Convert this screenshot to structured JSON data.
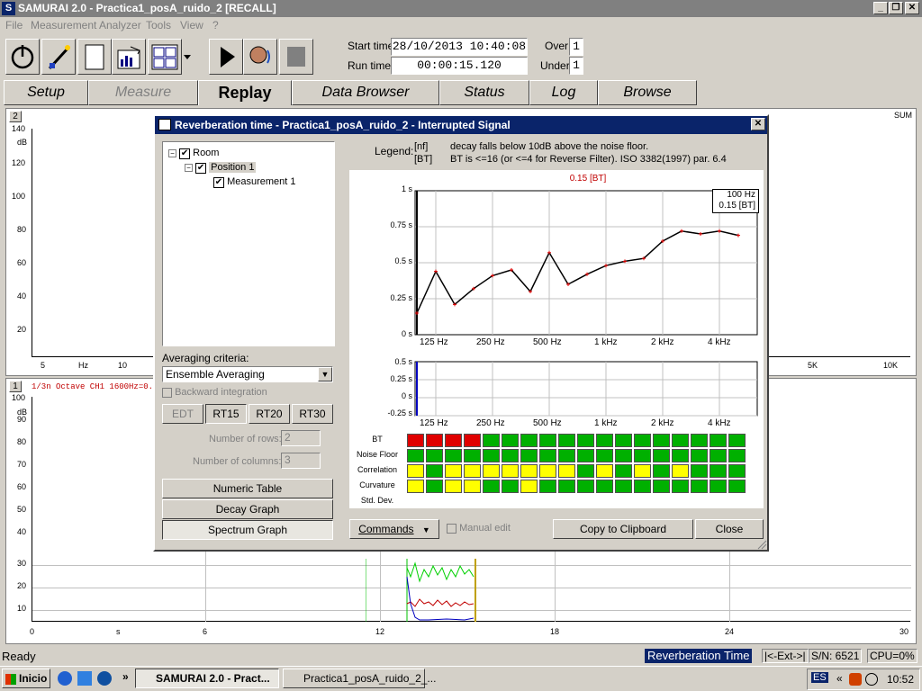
{
  "app": {
    "title": "SAMURAI 2.0 - Practica1_posA_ruido_2 [RECALL]",
    "icon_letter": "S"
  },
  "menu": [
    "File",
    "Measurement",
    "Analyzer",
    "Tools",
    "View",
    "?"
  ],
  "toolbar": {
    "start_time_label": "Start time",
    "start_time": "28/10/2013 10:40:08",
    "run_time_label": "Run time",
    "run_time": "00:00:15.120",
    "over_label": "Over",
    "over_value": "1",
    "under_label": "Under",
    "under_value": "1"
  },
  "tabs": [
    "Setup",
    "Measure",
    "Replay",
    "Data Browser",
    "Status",
    "Log",
    "Browse"
  ],
  "active_tab": "Replay",
  "panel_top": {
    "number": "2",
    "right_label": "SUM",
    "unit": "dB",
    "y_ticks": [
      "140",
      "120",
      "100",
      "80",
      "60",
      "40",
      "20"
    ],
    "x_ticks_left": [
      "5",
      "Hz",
      "10"
    ],
    "x_ticks_right": [
      "5K",
      "10K"
    ]
  },
  "panel_bottom": {
    "number": "1",
    "info": "1/3n Octave CH1 1600Hz=0.0dB",
    "unit": "dB",
    "y_ticks": [
      "100",
      "90",
      "80",
      "70",
      "60",
      "50",
      "40",
      "30",
      "20",
      "10"
    ],
    "x_ticks": [
      "0",
      "s",
      "6",
      "12",
      "18",
      "24",
      "30"
    ]
  },
  "dialog": {
    "title": "Reverberation time - Practica1_posA_ruido_2 - Interrupted Signal",
    "close_glyph": "✕",
    "tree": {
      "room": "Room",
      "position": "Position 1",
      "measurement": "Measurement 1"
    },
    "legend_label": "Legend:",
    "legend_nf_key": "[nf]",
    "legend_nf_text": "decay falls below 10dB above the noise floor.",
    "legend_bt_key": "[BT]",
    "legend_bt_text": "BT is <=16 (or <=4 for Reverse Filter). ISO 3382(1997) par. 6.4",
    "averaging_label": "Averaging criteria:",
    "averaging_value": "Ensemble Averaging",
    "backward_label": "Backward integration",
    "rt_buttons": [
      "EDT",
      "RT15",
      "RT20",
      "RT30"
    ],
    "rows_label": "Number of rows:",
    "rows_value": "2",
    "cols_label": "Number of columns:",
    "cols_value": "3",
    "view_buttons": [
      "Numeric Table",
      "Decay Graph",
      "Spectrum Graph"
    ],
    "commands_label": "Commands",
    "manual_edit_label": "Manual edit",
    "copy_label": "Copy to Clipboard",
    "close_label": "Close",
    "chart_header": "0.15 [BT]",
    "tooltip_freq": "100 Hz",
    "tooltip_val": "0.15 [BT]",
    "grid_rows": [
      "BT",
      "Noise Floor",
      "Correlation",
      "Curvature",
      "Std. Dev."
    ],
    "grid_cells": [
      [
        "r",
        "r",
        "r",
        "r",
        "g",
        "g",
        "g",
        "g",
        "g",
        "g",
        "g",
        "g",
        "g",
        "g",
        "g",
        "g",
        "g",
        "g"
      ],
      [
        "g",
        "g",
        "g",
        "g",
        "g",
        "g",
        "g",
        "g",
        "g",
        "g",
        "g",
        "g",
        "g",
        "g",
        "g",
        "g",
        "g",
        "g"
      ],
      [
        "y",
        "g",
        "y",
        "y",
        "y",
        "y",
        "y",
        "y",
        "y",
        "g",
        "y",
        "g",
        "y",
        "g",
        "y",
        "g",
        "g",
        "g"
      ],
      [
        "y",
        "g",
        "y",
        "y",
        "g",
        "g",
        "y",
        "g",
        "g",
        "g",
        "g",
        "g",
        "g",
        "g",
        "g",
        "g",
        "g",
        "g"
      ]
    ],
    "colors": {
      "green": "#00b000",
      "red": "#e00000",
      "yellow": "#ffff00"
    }
  },
  "chart_data": [
    {
      "type": "line",
      "x": [
        "100 Hz",
        "125 Hz",
        "160 Hz",
        "200 Hz",
        "250 Hz",
        "315 Hz",
        "400 Hz",
        "500 Hz",
        "630 Hz",
        "800 Hz",
        "1 kHz",
        "1.25 kHz",
        "1.6 kHz",
        "2 kHz",
        "2.5 kHz",
        "3.15 kHz",
        "4 kHz",
        "5 kHz"
      ],
      "x_tick_labels": [
        "125 Hz",
        "250 Hz",
        "500 Hz",
        "1 kHz",
        "2 kHz",
        "4 kHz"
      ],
      "y_tick_labels": [
        "1 s",
        "0.75 s",
        "0.5 s",
        "0.25 s",
        "0 s"
      ],
      "values": [
        0.15,
        0.44,
        0.21,
        0.32,
        0.41,
        0.45,
        0.3,
        0.57,
        0.35,
        0.42,
        0.48,
        0.51,
        0.53,
        0.65,
        0.72,
        0.7,
        0.72,
        0.69
      ],
      "ylim": [
        0,
        1
      ],
      "grid": true
    },
    {
      "type": "line",
      "x_tick_labels": [
        "125 Hz",
        "250 Hz",
        "500 Hz",
        "1 kHz",
        "2 kHz",
        "4 kHz"
      ],
      "y_tick_labels": [
        "0.5 s",
        "0.25 s",
        "0 s",
        "-0.25 s"
      ],
      "values": [],
      "ylim": [
        -0.25,
        0.5
      ],
      "grid": true
    }
  ],
  "status": {
    "left": "Ready",
    "mode": "Reverberation Time",
    "ext": "|<-Ext->|",
    "sn": "S/N: 6521",
    "cpu": "CPU=0%"
  },
  "taskbar": {
    "start": "Inicio",
    "task1": "SAMURAI 2.0 - Pract...",
    "task2": "Practica1_posA_ruido_2_...",
    "lang": "ES",
    "clock": "10:52"
  }
}
